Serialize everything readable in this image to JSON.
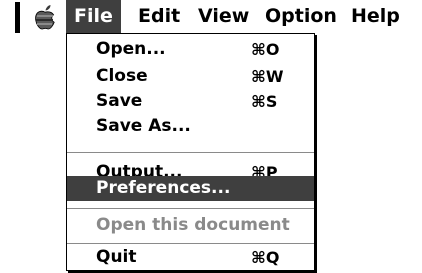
{
  "menubar": {
    "apple_icon": "apple-icon",
    "titles": [
      "File",
      "Edit",
      "View",
      "Option",
      "Help"
    ],
    "active": "File"
  },
  "file_menu": {
    "items": [
      {
        "label": "Open...",
        "shortcut": "⌘O",
        "enabled": true,
        "highlighted": false
      },
      {
        "label": "Close",
        "shortcut": "⌘W",
        "enabled": true,
        "highlighted": false
      },
      {
        "label": "Save",
        "shortcut": "⌘S",
        "enabled": true,
        "highlighted": false
      },
      {
        "label": "Save As...",
        "shortcut": "",
        "enabled": true,
        "highlighted": false
      },
      {
        "label": "Output...",
        "shortcut": "⌘P",
        "enabled": true,
        "highlighted": false
      },
      {
        "label": "Preferences...",
        "shortcut": "",
        "enabled": true,
        "highlighted": true
      },
      {
        "label": "Open this document",
        "shortcut": "",
        "enabled": false,
        "highlighted": false
      },
      {
        "label": "Quit",
        "shortcut": "⌘Q",
        "enabled": true,
        "highlighted": false
      }
    ]
  },
  "colors": {
    "highlight": "#3f3f3f",
    "disabled_text": "#8a8a8a",
    "text": "#000000",
    "background": "#ffffff"
  }
}
